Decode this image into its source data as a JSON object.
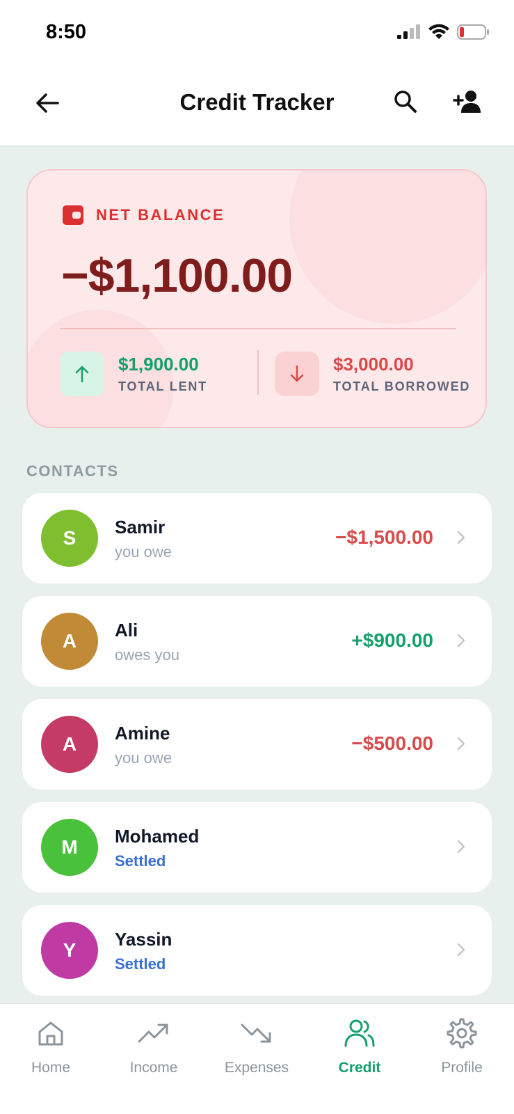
{
  "status_bar": {
    "time": "8:50"
  },
  "header": {
    "title": "Credit Tracker"
  },
  "balance": {
    "label": "NET BALANCE",
    "amount": "−$1,100.00",
    "lent_amount": "$1,900.00",
    "lent_label": "TOTAL LENT",
    "borrowed_amount": "$3,000.00",
    "borrowed_label": "TOTAL BORROWED"
  },
  "contacts": {
    "section_label": "CONTACTS",
    "items": [
      {
        "initial": "S",
        "name": "Samir",
        "status": "you owe",
        "amount": "−$1,500.00",
        "avatar_color": "#7fbf2f"
      },
      {
        "initial": "A",
        "name": "Ali",
        "status": "owes you",
        "amount": "+$900.00",
        "avatar_color": "#c08a37"
      },
      {
        "initial": "A",
        "name": "Amine",
        "status": "you owe",
        "amount": "−$500.00",
        "avatar_color": "#c43b68"
      },
      {
        "initial": "M",
        "name": "Mohamed",
        "status": "Settled",
        "amount": "",
        "avatar_color": "#49c13a"
      },
      {
        "initial": "Y",
        "name": "Yassin",
        "status": "Settled",
        "amount": "",
        "avatar_color": "#c03aa3"
      }
    ]
  },
  "bottom_nav": {
    "items": [
      {
        "label": "Home",
        "icon": "home-icon"
      },
      {
        "label": "Income",
        "icon": "trending-up-icon"
      },
      {
        "label": "Expenses",
        "icon": "trending-down-icon"
      },
      {
        "label": "Credit",
        "icon": "users-icon",
        "active": true
      },
      {
        "label": "Profile",
        "icon": "gear-icon"
      }
    ]
  },
  "colors": {
    "accent_green": "#15a06a",
    "negative_red": "#d94a4a",
    "balance_dark_red": "#7f1d1d",
    "settled_blue": "#3a6fd8"
  }
}
